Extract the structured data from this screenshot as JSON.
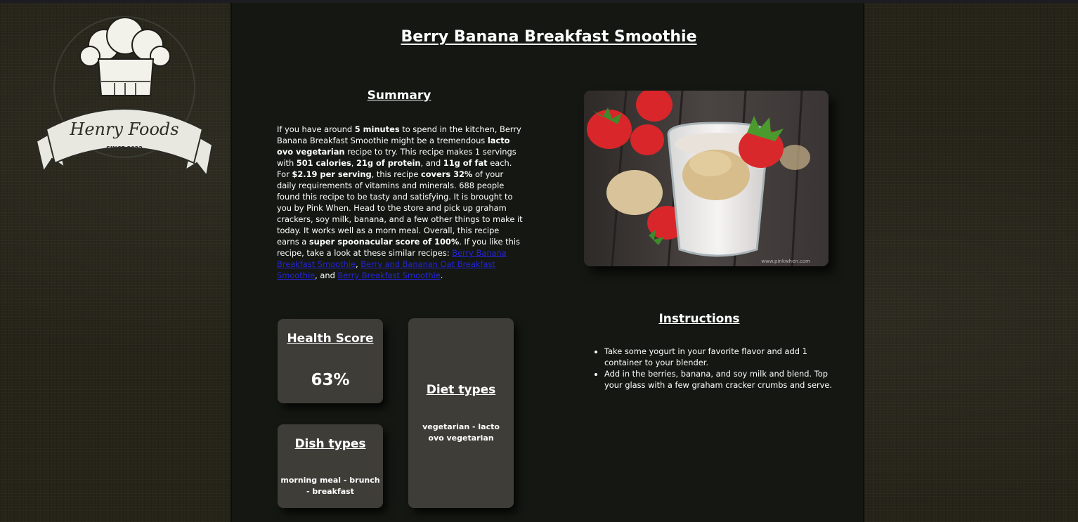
{
  "logo": {
    "brand": "Henry Foods",
    "since": "SINCE 2022"
  },
  "recipe": {
    "title": "Berry Banana Breakfast Smoothie"
  },
  "summary": {
    "heading": "Summary",
    "t1": "If you have around ",
    "b1": "5 minutes",
    "t2": " to spend in the kitchen, Berry Banana Breakfast Smoothie might be a tremendous ",
    "b2": "lacto ovo vegetarian",
    "t3": " recipe to try. This recipe makes 1 servings with ",
    "b3": "501 calories",
    "t4": ", ",
    "b4": "21g of protein",
    "t5": ", and ",
    "b5": "11g of fat",
    "t6": " each. For ",
    "b6": "$2.19 per serving",
    "t7": ", this recipe ",
    "b7": "covers 32%",
    "t8": " of your daily requirements of vitamins and minerals. 688 people found this recipe to be tasty and satisfying. It is brought to you by Pink When. Head to the store and pick up graham crackers, soy milk, banana, and a few other things to make it today. It works well as a morn meal. Overall, this recipe earns a ",
    "b8": "super spoonacular score of 100%",
    "t9": ". If you like this recipe, take a look at these similar recipes: ",
    "link1": "Berry Banana Breakfast Smoothie",
    "t10": ", ",
    "link2": "Berry and Bananan Oat Breakfast Smoothie",
    "t11": ", and ",
    "link3": "Berry Breakfast Smoothie",
    "t12": "."
  },
  "photo": {
    "credit": "www.pinkwhen.com"
  },
  "instructions": {
    "heading": "Instructions",
    "steps": [
      "Take some yogurt in your favorite flavor and add 1 container to your blender.",
      "Add in the berries, banana, and soy milk and blend. Top your glass with a few graham cracker crumbs and serve."
    ]
  },
  "cards": {
    "health": {
      "heading": "Health Score",
      "value": "63%"
    },
    "diet": {
      "heading": "Diet types",
      "value": "vegetarian - lacto ovo vegetarian"
    },
    "dish": {
      "heading": "Dish types",
      "value": "morning meal - brunch - breakfast"
    }
  }
}
